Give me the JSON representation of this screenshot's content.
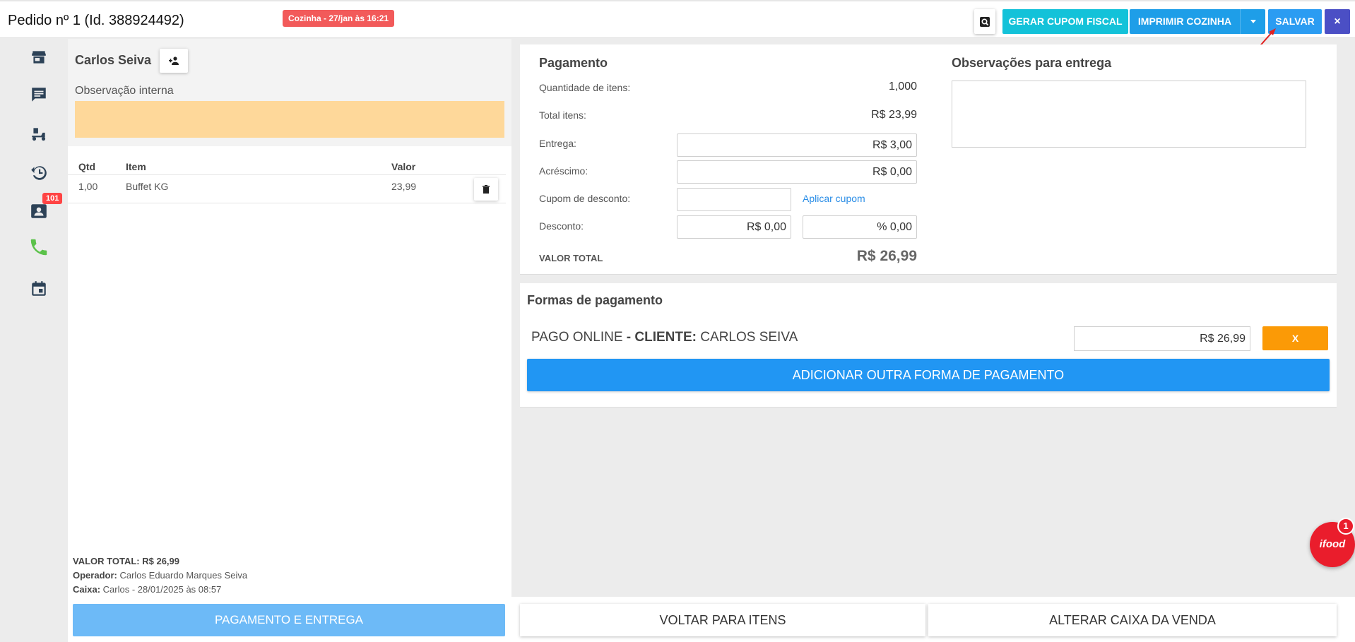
{
  "header": {
    "order_title": "Pedido nº 1 (Id. 388924492)",
    "kitchen_badge": "Cozinha - 27/jan às 16:21",
    "buttons": {
      "gerar_cupom": "GERAR CUPOM FISCAL",
      "imprimir_cozinha": "IMPRIMIR COZINHA",
      "salvar": "SALVAR",
      "close": "×"
    }
  },
  "nav": {
    "badge": "101",
    "icons": [
      "store-icon",
      "chat-icon",
      "delivery-icon",
      "history-icon",
      "contact-card-icon",
      "phone-icon",
      "calendar-icon"
    ]
  },
  "customer": {
    "name": "Carlos Seiva",
    "obs_label": "Observação interna",
    "obs_value": ""
  },
  "items": {
    "headers": {
      "qtd": "Qtd",
      "item": "Item",
      "valor": "Valor"
    },
    "rows": [
      {
        "qtd": "1,00",
        "item": "Buffet KG",
        "valor": "23,99"
      }
    ]
  },
  "summary": {
    "valor_total_label": "VALOR TOTAL:",
    "valor_total": "R$ 26,99",
    "operador_label": "Operador:",
    "operador": "Carlos Eduardo Marques Seiva",
    "caixa_label": "Caixa:",
    "caixa": "Carlos - 28/01/2025 às 08:57",
    "pagamento_button": "PAGAMENTO E ENTREGA"
  },
  "payment": {
    "title": "Pagamento",
    "quantidade_label": "Quantidade de itens:",
    "quantidade": "1,000",
    "total_itens_label": "Total itens:",
    "total_itens": "R$ 23,99",
    "entrega_label": "Entrega:",
    "entrega": "R$ 3,00",
    "acrescimo_label": "Acréscimo:",
    "acrescimo": "R$ 0,00",
    "cupom_label": "Cupom de desconto:",
    "cupom_value": "",
    "aplicar_cupom": "Aplicar cupom",
    "desconto_label": "Desconto:",
    "desconto_valor": "R$ 0,00",
    "desconto_percent": "% 0,00",
    "valor_total_label": "VALOR TOTAL",
    "valor_total": "R$ 26,99",
    "obs_entrega_title": "Observações para entrega",
    "obs_entrega_value": ""
  },
  "forms": {
    "title": "Formas de pagamento",
    "method": "PAGO ONLINE",
    "separator": " - ",
    "client_label": "CLIENTE:",
    "client_name": "CARLOS SEIVA",
    "amount": "R$ 26,99",
    "remove_button": "X",
    "add_button": "ADICIONAR OUTRA FORMA DE PAGAMENTO"
  },
  "bottom": {
    "voltar": "VOLTAR PARA ITENS",
    "alterar": "ALTERAR CAIXA DA VENDA"
  },
  "ifood": {
    "logo": "ifood",
    "badge": "1"
  },
  "colors": {
    "cupom_button": "#13c2d9",
    "imprimir_button": "#1e9ee8",
    "salvar_button": "#2b9cf2",
    "close_button": "#4b4fc5",
    "kitchen_badge": "#f25a5a",
    "obs_interna": "#fed89a",
    "remove_button": "#fb9a06",
    "add_button": "#2196f3",
    "ifood": "#ea1d2c"
  }
}
